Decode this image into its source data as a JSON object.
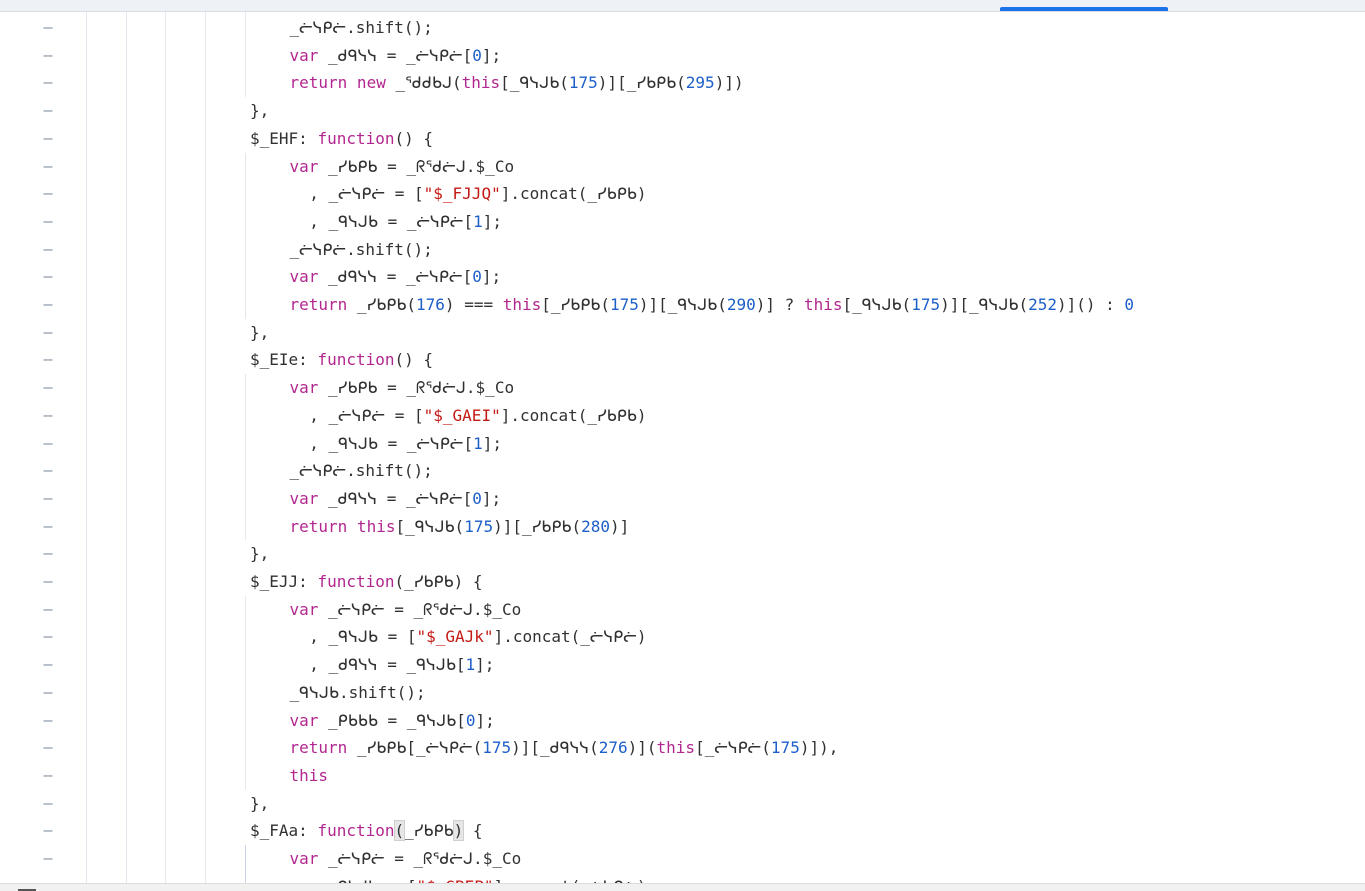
{
  "code_lines": [
    [
      {
        "t": "_ᓖᓭᑭᓖ.shift();"
      }
    ],
    [
      {
        "t": "var",
        "k": "kw"
      },
      {
        "t": " _ᑯᑫᓭᓭ = _ᓖᓭᑭᓖ["
      },
      {
        "t": "0",
        "k": "num"
      },
      {
        "t": "];"
      }
    ],
    [
      {
        "t": "return new",
        "k": "kw"
      },
      {
        "t": " _ᕐᑯᑯᑲᒍ("
      },
      {
        "t": "this",
        "k": "kw"
      },
      {
        "t": "[_ᑫᓭᒍᑲ("
      },
      {
        "t": "175",
        "k": "num"
      },
      {
        "t": ")][_ᓯᑲᑭᑲ("
      },
      {
        "t": "295",
        "k": "num"
      },
      {
        "t": ")])"
      }
    ],
    [
      {
        "t": "},"
      }
    ],
    [
      {
        "t": "$_EHF: "
      },
      {
        "t": "function",
        "k": "kw"
      },
      {
        "t": "() {"
      }
    ],
    [
      {
        "t": "var",
        "k": "kw"
      },
      {
        "t": " _ᓯᑲᑭᑲ = _ᖇᕐᑯᓖᒍ.$_Co"
      }
    ],
    [
      {
        "t": ", _ᓖᓭᑭᓖ = ["
      },
      {
        "t": "\"$_FJJQ\"",
        "k": "str"
      },
      {
        "t": "].concat(_ᓯᑲᑭᑲ)"
      }
    ],
    [
      {
        "t": ", _ᑫᓭᒍᑲ = _ᓖᓭᑭᓖ["
      },
      {
        "t": "1",
        "k": "num"
      },
      {
        "t": "];"
      }
    ],
    [
      {
        "t": "_ᓖᓭᑭᓖ.shift();"
      }
    ],
    [
      {
        "t": "var",
        "k": "kw"
      },
      {
        "t": " _ᑯᑫᓭᓭ = _ᓖᓭᑭᓖ["
      },
      {
        "t": "0",
        "k": "num"
      },
      {
        "t": "];"
      }
    ],
    [
      {
        "t": "return",
        "k": "kw"
      },
      {
        "t": " _ᓯᑲᑭᑲ("
      },
      {
        "t": "176",
        "k": "num"
      },
      {
        "t": ") === "
      },
      {
        "t": "this",
        "k": "kw"
      },
      {
        "t": "[_ᓯᑲᑭᑲ("
      },
      {
        "t": "175",
        "k": "num"
      },
      {
        "t": ")][_ᑫᓭᒍᑲ("
      },
      {
        "t": "290",
        "k": "num"
      },
      {
        "t": ")] ? "
      },
      {
        "t": "this",
        "k": "kw"
      },
      {
        "t": "[_ᑫᓭᒍᑲ("
      },
      {
        "t": "175",
        "k": "num"
      },
      {
        "t": ")][_ᑫᓭᒍᑲ("
      },
      {
        "t": "252",
        "k": "num"
      },
      {
        "t": ")]() : "
      },
      {
        "t": "0",
        "k": "num"
      }
    ],
    [
      {
        "t": "},"
      }
    ],
    [
      {
        "t": "$_EIe: "
      },
      {
        "t": "function",
        "k": "kw"
      },
      {
        "t": "() {"
      }
    ],
    [
      {
        "t": "var",
        "k": "kw"
      },
      {
        "t": " _ᓯᑲᑭᑲ = _ᖇᕐᑯᓖᒍ.$_Co"
      }
    ],
    [
      {
        "t": ", _ᓖᓭᑭᓖ = ["
      },
      {
        "t": "\"$_GAEI\"",
        "k": "str"
      },
      {
        "t": "].concat(_ᓯᑲᑭᑲ)"
      }
    ],
    [
      {
        "t": ", _ᑫᓭᒍᑲ = _ᓖᓭᑭᓖ["
      },
      {
        "t": "1",
        "k": "num"
      },
      {
        "t": "];"
      }
    ],
    [
      {
        "t": "_ᓖᓭᑭᓖ.shift();"
      }
    ],
    [
      {
        "t": "var",
        "k": "kw"
      },
      {
        "t": " _ᑯᑫᓭᓭ = _ᓖᓭᑭᓖ["
      },
      {
        "t": "0",
        "k": "num"
      },
      {
        "t": "];"
      }
    ],
    [
      {
        "t": "return this",
        "k": "kw"
      },
      {
        "t": "[_ᑫᓭᒍᑲ("
      },
      {
        "t": "175",
        "k": "num"
      },
      {
        "t": ")][_ᓯᑲᑭᑲ("
      },
      {
        "t": "280",
        "k": "num"
      },
      {
        "t": ")]"
      }
    ],
    [
      {
        "t": "},"
      }
    ],
    [
      {
        "t": "$_EJJ: "
      },
      {
        "t": "function",
        "k": "kw"
      },
      {
        "t": "(_ᓯᑲᑭᑲ) {"
      }
    ],
    [
      {
        "t": "var",
        "k": "kw"
      },
      {
        "t": " _ᓖᓭᑭᓖ = _ᖇᕐᑯᓖᒍ.$_Co"
      }
    ],
    [
      {
        "t": ", _ᑫᓭᒍᑲ = ["
      },
      {
        "t": "\"$_GAJk\"",
        "k": "str"
      },
      {
        "t": "].concat(_ᓖᓭᑭᓖ)"
      }
    ],
    [
      {
        "t": ", _ᑯᑫᓭᓭ = _ᑫᓭᒍᑲ["
      },
      {
        "t": "1",
        "k": "num"
      },
      {
        "t": "];"
      }
    ],
    [
      {
        "t": "_ᑫᓭᒍᑲ.shift();"
      }
    ],
    [
      {
        "t": "var",
        "k": "kw"
      },
      {
        "t": " _ᑭᑲᑲᑲ = _ᑫᓭᒍᑲ["
      },
      {
        "t": "0",
        "k": "num"
      },
      {
        "t": "];"
      }
    ],
    [
      {
        "t": "return",
        "k": "kw"
      },
      {
        "t": " _ᓯᑲᑭᑲ[_ᓖᓭᑭᓖ("
      },
      {
        "t": "175",
        "k": "num"
      },
      {
        "t": ")][_ᑯᑫᓭᓭ("
      },
      {
        "t": "276",
        "k": "num"
      },
      {
        "t": ")]("
      },
      {
        "t": "this",
        "k": "kw"
      },
      {
        "t": "[_ᓖᓭᑭᓖ("
      },
      {
        "t": "175",
        "k": "num"
      },
      {
        "t": ")]),"
      }
    ],
    [
      {
        "t": "this",
        "k": "kw"
      }
    ],
    [
      {
        "t": "},"
      }
    ],
    [
      {
        "t": "$_FAa: "
      },
      {
        "t": "function",
        "k": "kw"
      },
      {
        "t": "(",
        "k": "bracket-hl"
      },
      {
        "t": "_ᓯᑲᑭᑲ"
      },
      {
        "t": ")",
        "k": "bracket-hl"
      },
      {
        "t": " {"
      }
    ],
    [
      {
        "t": "var",
        "k": "kw"
      },
      {
        "t": " _ᓖᓭᑭᓖ = _ᖇᕐᑯᓖᒍ.$_Co"
      }
    ],
    [
      {
        "t": ", _ᑫᓭᒍᑲ = ["
      },
      {
        "t": "\"$_GBEP\"",
        "k": "str"
      },
      {
        "t": "].concat(_ᓖᓭᑭᓖ)"
      }
    ]
  ],
  "gutter_marks": [
    "–",
    "–",
    "–",
    "–",
    "–",
    "–",
    "–",
    "–",
    "–",
    "–",
    "–",
    "–",
    "–",
    "–",
    "–",
    "–",
    "–",
    "–",
    "–",
    "–",
    "–",
    "–",
    "–",
    "–",
    "–",
    "–",
    "–",
    "–",
    "–",
    "–",
    "–",
    "–"
  ]
}
